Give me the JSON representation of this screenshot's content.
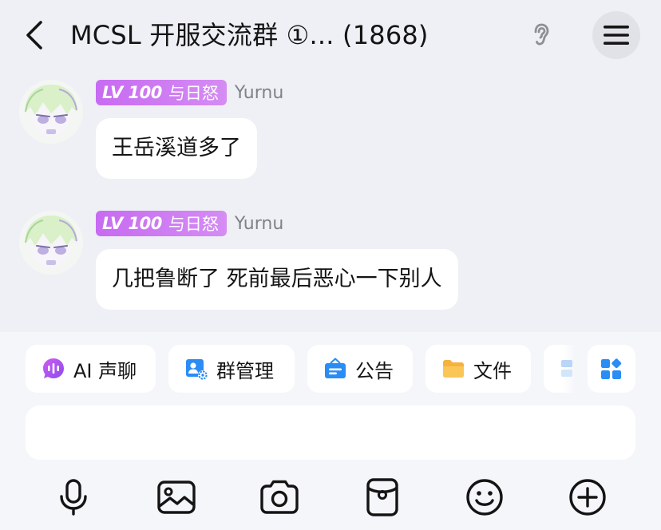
{
  "header": {
    "title": "MCSL 开服交流群 ①... (1868)",
    "back_icon": "chevron-left-icon",
    "ear_icon": "ear-icon",
    "menu_icon": "hamburger-menu-icon"
  },
  "messages": [
    {
      "badge_level": "LV 100",
      "badge_title": "与日怒",
      "sender": "Yurnu",
      "text": "王岳溪道多了"
    },
    {
      "badge_level": "LV 100",
      "badge_title": "与日怒",
      "sender": "Yurnu",
      "text": "几把鲁断了 死前最后恶心一下别人"
    }
  ],
  "shortcuts": [
    {
      "label": "AI 声聊",
      "icon": "ai-voice-chat-icon"
    },
    {
      "label": "群管理",
      "icon": "group-manage-icon"
    },
    {
      "label": "公告",
      "icon": "announcement-icon"
    },
    {
      "label": "文件",
      "icon": "folder-icon"
    }
  ],
  "more_apps_icon": "apps-grid-icon",
  "input": {
    "value": "",
    "placeholder": ""
  },
  "toolbar": [
    "microphone-icon",
    "image-icon",
    "camera-icon",
    "red-packet-icon",
    "emoji-icon",
    "plus-circle-icon"
  ],
  "colors": {
    "background": "#eef0f5",
    "badge": "#c76bf2",
    "sender_name": "#7f8288",
    "accent_blue": "#2a8cf5",
    "ai_purple": "#b44ef0",
    "folder_orange": "#f6b23e"
  }
}
